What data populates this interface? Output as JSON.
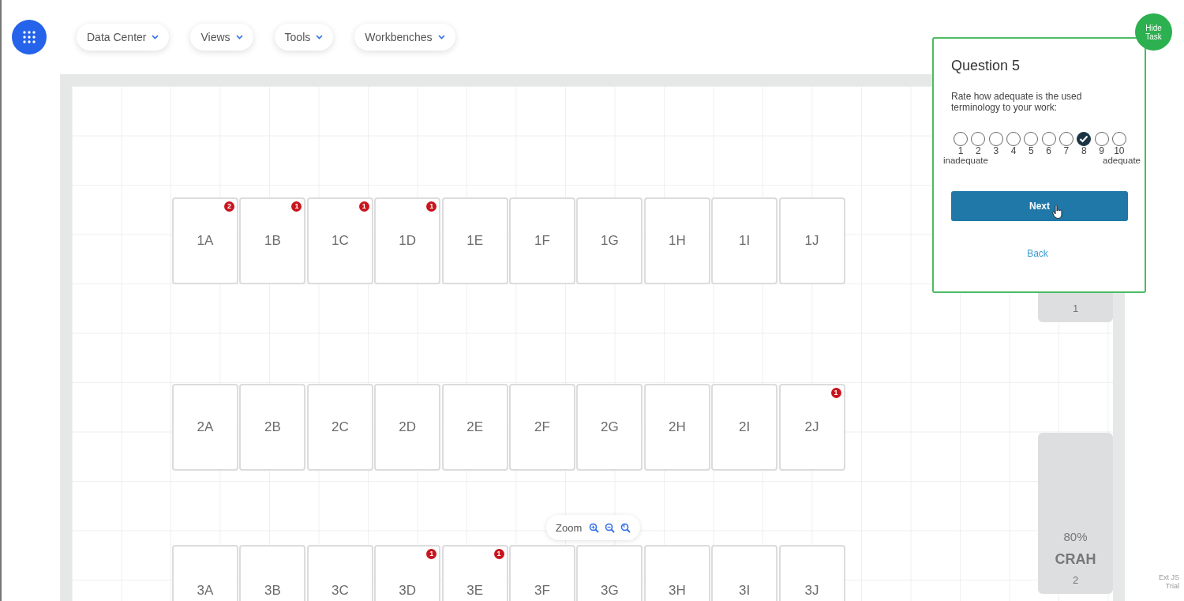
{
  "menu": [
    {
      "label": "Data Center"
    },
    {
      "label": "Views"
    },
    {
      "label": "Tools"
    },
    {
      "label": "Workbenches"
    }
  ],
  "racks": [
    {
      "label": "1A",
      "alerts": "2"
    },
    {
      "label": "1B",
      "alerts": "1"
    },
    {
      "label": "1C",
      "alerts": "1"
    },
    {
      "label": "1D",
      "alerts": "1"
    },
    {
      "label": "1E"
    },
    {
      "label": "1F"
    },
    {
      "label": "1G"
    },
    {
      "label": "1H"
    },
    {
      "label": "1I"
    },
    {
      "label": "1J"
    },
    {
      "label": "2A"
    },
    {
      "label": "2B"
    },
    {
      "label": "2C"
    },
    {
      "label": "2D"
    },
    {
      "label": "2E"
    },
    {
      "label": "2F"
    },
    {
      "label": "2G"
    },
    {
      "label": "2H"
    },
    {
      "label": "2I"
    },
    {
      "label": "2J",
      "alerts": "1"
    },
    {
      "label": "3A"
    },
    {
      "label": "3B"
    },
    {
      "label": "3C"
    },
    {
      "label": "3D",
      "alerts": "1"
    },
    {
      "label": "3E",
      "alerts": "1"
    },
    {
      "label": "3F"
    },
    {
      "label": "3G"
    },
    {
      "label": "3H"
    },
    {
      "label": "3I"
    },
    {
      "label": "3J"
    }
  ],
  "crah_units": [
    {
      "number": "1"
    },
    {
      "load": "80%",
      "name": "CRAH",
      "number": "2"
    }
  ],
  "zoom": {
    "label": "Zoom"
  },
  "trial_note": "Ext JS Trial",
  "task": {
    "hide_button": "Hide Task",
    "title": "Question 5",
    "prompt": "Rate how adequate is the used terminology to your work:",
    "rating": [
      {
        "label": "1",
        "selected": false
      },
      {
        "label": "2",
        "selected": false
      },
      {
        "label": "3",
        "selected": false
      },
      {
        "label": "4",
        "selected": false
      },
      {
        "label": "5",
        "selected": false
      },
      {
        "label": "6",
        "selected": false
      },
      {
        "label": "7",
        "selected": false
      },
      {
        "label": "8",
        "selected": true
      },
      {
        "label": "9",
        "selected": false
      },
      {
        "label": "10",
        "selected": false
      }
    ],
    "min_label": "inadequate",
    "max_label": "adequate",
    "next_button": "Next",
    "back_link": "Back"
  }
}
